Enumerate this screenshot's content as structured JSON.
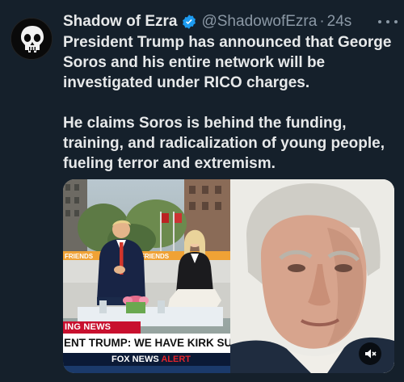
{
  "author": {
    "display_name": "Shadow of Ezra",
    "handle": "@ShadowofEzra",
    "separator": "·",
    "timestamp": "24s"
  },
  "post": {
    "paragraph_1": "President Trump has announced that George Soros and his entire network will be investigated under RICO charges.",
    "paragraph_2": "He claims Soros is behind the funding, training, and radicalization of young people, fueling terror and extremism."
  },
  "media": {
    "news_label": "ING NEWS",
    "headline": "ENT TRUMP: WE HAVE KIRK SUSPECT",
    "network": "FOX NEWS",
    "alert": "ALERT",
    "set_text_left": "FRIENDS",
    "set_text_right": "FRIENDS"
  },
  "icons": {
    "avatar": "skull-avatar",
    "verified": "verified-badge-icon",
    "more": "more-options-icon",
    "mute": "mute-icon"
  },
  "colors": {
    "background": "#15202b",
    "verified_blue": "#1d9bf0",
    "secondary_text": "#8b98a5",
    "fox_red": "#c8102e"
  }
}
